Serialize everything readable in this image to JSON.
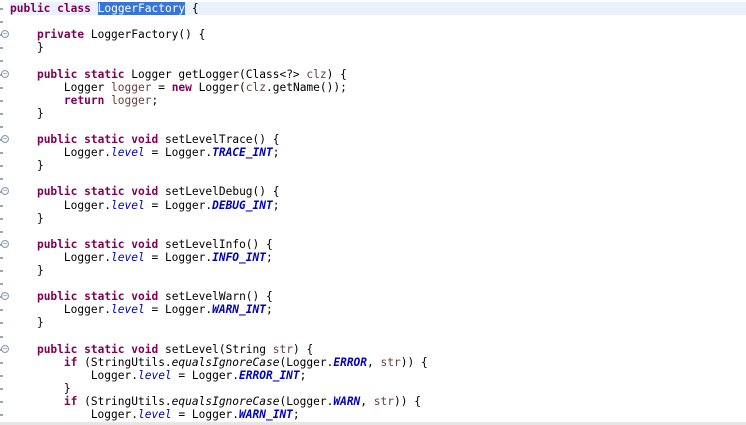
{
  "editor": {
    "language": "java",
    "colors": {
      "keyword": "#7f0055",
      "field": "#0000c0",
      "local_variable": "#6a3e3e",
      "selection": "#3875d7",
      "current_line": "#eaf1fb"
    },
    "selected_text": "LoggerFactory",
    "lines": [
      {
        "tokens": [
          {
            "t": "public",
            "s": "kw"
          },
          {
            "t": " "
          },
          {
            "t": "class",
            "s": "kw"
          },
          {
            "t": " "
          },
          {
            "t": "LoggerFactory",
            "s": "sel"
          },
          {
            "t": " {"
          }
        ]
      },
      {
        "tokens": []
      },
      {
        "tokens": [
          {
            "t": "    "
          },
          {
            "t": "private",
            "s": "kw"
          },
          {
            "t": " LoggerFactory() {"
          }
        ]
      },
      {
        "tokens": [
          {
            "t": "    }"
          }
        ]
      },
      {
        "tokens": []
      },
      {
        "tokens": [
          {
            "t": "    "
          },
          {
            "t": "public",
            "s": "kw"
          },
          {
            "t": " "
          },
          {
            "t": "static",
            "s": "kw"
          },
          {
            "t": " Logger getLogger(Class<?> "
          },
          {
            "t": "clz",
            "s": "local"
          },
          {
            "t": ") {"
          }
        ]
      },
      {
        "tokens": [
          {
            "t": "        Logger "
          },
          {
            "t": "logger",
            "s": "local"
          },
          {
            "t": " = "
          },
          {
            "t": "new",
            "s": "kw"
          },
          {
            "t": " Logger("
          },
          {
            "t": "clz",
            "s": "local"
          },
          {
            "t": ".getName());"
          }
        ]
      },
      {
        "tokens": [
          {
            "t": "        "
          },
          {
            "t": "return",
            "s": "kw"
          },
          {
            "t": " "
          },
          {
            "t": "logger",
            "s": "local"
          },
          {
            "t": ";"
          }
        ]
      },
      {
        "tokens": [
          {
            "t": "    }"
          }
        ]
      },
      {
        "tokens": []
      },
      {
        "tokens": [
          {
            "t": "    "
          },
          {
            "t": "public",
            "s": "kw"
          },
          {
            "t": " "
          },
          {
            "t": "static",
            "s": "kw"
          },
          {
            "t": " "
          },
          {
            "t": "void",
            "s": "kw"
          },
          {
            "t": " setLevelTrace() {"
          }
        ]
      },
      {
        "tokens": [
          {
            "t": "        Logger."
          },
          {
            "t": "level",
            "s": "sfld"
          },
          {
            "t": " = Logger."
          },
          {
            "t": "TRACE_INT",
            "s": "sconst"
          },
          {
            "t": ";"
          }
        ]
      },
      {
        "tokens": [
          {
            "t": "    }"
          }
        ]
      },
      {
        "tokens": []
      },
      {
        "tokens": [
          {
            "t": "    "
          },
          {
            "t": "public",
            "s": "kw"
          },
          {
            "t": " "
          },
          {
            "t": "static",
            "s": "kw"
          },
          {
            "t": " "
          },
          {
            "t": "void",
            "s": "kw"
          },
          {
            "t": " setLevelDebug() {"
          }
        ]
      },
      {
        "tokens": [
          {
            "t": "        Logger."
          },
          {
            "t": "level",
            "s": "sfld"
          },
          {
            "t": " = Logger."
          },
          {
            "t": "DEBUG_INT",
            "s": "sconst"
          },
          {
            "t": ";"
          }
        ]
      },
      {
        "tokens": [
          {
            "t": "    }"
          }
        ]
      },
      {
        "tokens": []
      },
      {
        "tokens": [
          {
            "t": "    "
          },
          {
            "t": "public",
            "s": "kw"
          },
          {
            "t": " "
          },
          {
            "t": "static",
            "s": "kw"
          },
          {
            "t": " "
          },
          {
            "t": "void",
            "s": "kw"
          },
          {
            "t": " setLevelInfo() {"
          }
        ]
      },
      {
        "tokens": [
          {
            "t": "        Logger."
          },
          {
            "t": "level",
            "s": "sfld"
          },
          {
            "t": " = Logger."
          },
          {
            "t": "INFO_INT",
            "s": "sconst"
          },
          {
            "t": ";"
          }
        ]
      },
      {
        "tokens": [
          {
            "t": "    }"
          }
        ]
      },
      {
        "tokens": []
      },
      {
        "tokens": [
          {
            "t": "    "
          },
          {
            "t": "public",
            "s": "kw"
          },
          {
            "t": " "
          },
          {
            "t": "static",
            "s": "kw"
          },
          {
            "t": " "
          },
          {
            "t": "void",
            "s": "kw"
          },
          {
            "t": " setLevelWarn() {"
          }
        ]
      },
      {
        "tokens": [
          {
            "t": "        Logger."
          },
          {
            "t": "level",
            "s": "sfld"
          },
          {
            "t": " = Logger."
          },
          {
            "t": "WARN_INT",
            "s": "sconst"
          },
          {
            "t": ";"
          }
        ]
      },
      {
        "tokens": [
          {
            "t": "    }"
          }
        ]
      },
      {
        "tokens": []
      },
      {
        "tokens": [
          {
            "t": "    "
          },
          {
            "t": "public",
            "s": "kw"
          },
          {
            "t": " "
          },
          {
            "t": "static",
            "s": "kw"
          },
          {
            "t": " "
          },
          {
            "t": "void",
            "s": "kw"
          },
          {
            "t": " setLevel(String "
          },
          {
            "t": "str",
            "s": "local"
          },
          {
            "t": ") {"
          }
        ]
      },
      {
        "tokens": [
          {
            "t": "        "
          },
          {
            "t": "if",
            "s": "kw"
          },
          {
            "t": " (StringUtils."
          },
          {
            "t": "equalsIgnoreCase",
            "s": "smeth"
          },
          {
            "t": "(Logger."
          },
          {
            "t": "ERROR",
            "s": "sconst"
          },
          {
            "t": ", "
          },
          {
            "t": "str",
            "s": "local"
          },
          {
            "t": ")) {"
          }
        ]
      },
      {
        "tokens": [
          {
            "t": "            Logger."
          },
          {
            "t": "level",
            "s": "sfld"
          },
          {
            "t": " = Logger."
          },
          {
            "t": "ERROR_INT",
            "s": "sconst"
          },
          {
            "t": ";"
          }
        ]
      },
      {
        "tokens": [
          {
            "t": "        }"
          }
        ]
      },
      {
        "tokens": [
          {
            "t": "        "
          },
          {
            "t": "if",
            "s": "kw"
          },
          {
            "t": " (StringUtils."
          },
          {
            "t": "equalsIgnoreCase",
            "s": "smeth"
          },
          {
            "t": "(Logger."
          },
          {
            "t": "WARN",
            "s": "sconst"
          },
          {
            "t": ", "
          },
          {
            "t": "str",
            "s": "local"
          },
          {
            "t": ")) {"
          }
        ]
      },
      {
        "tokens": [
          {
            "t": "            Logger."
          },
          {
            "t": "level",
            "s": "sfld"
          },
          {
            "t": " = Logger."
          },
          {
            "t": "WARN_INT",
            "s": "sconst"
          },
          {
            "t": ";"
          }
        ]
      }
    ],
    "fold_icon_lines": [
      2,
      5,
      10,
      14,
      18,
      22,
      26
    ],
    "current_line": 0
  }
}
